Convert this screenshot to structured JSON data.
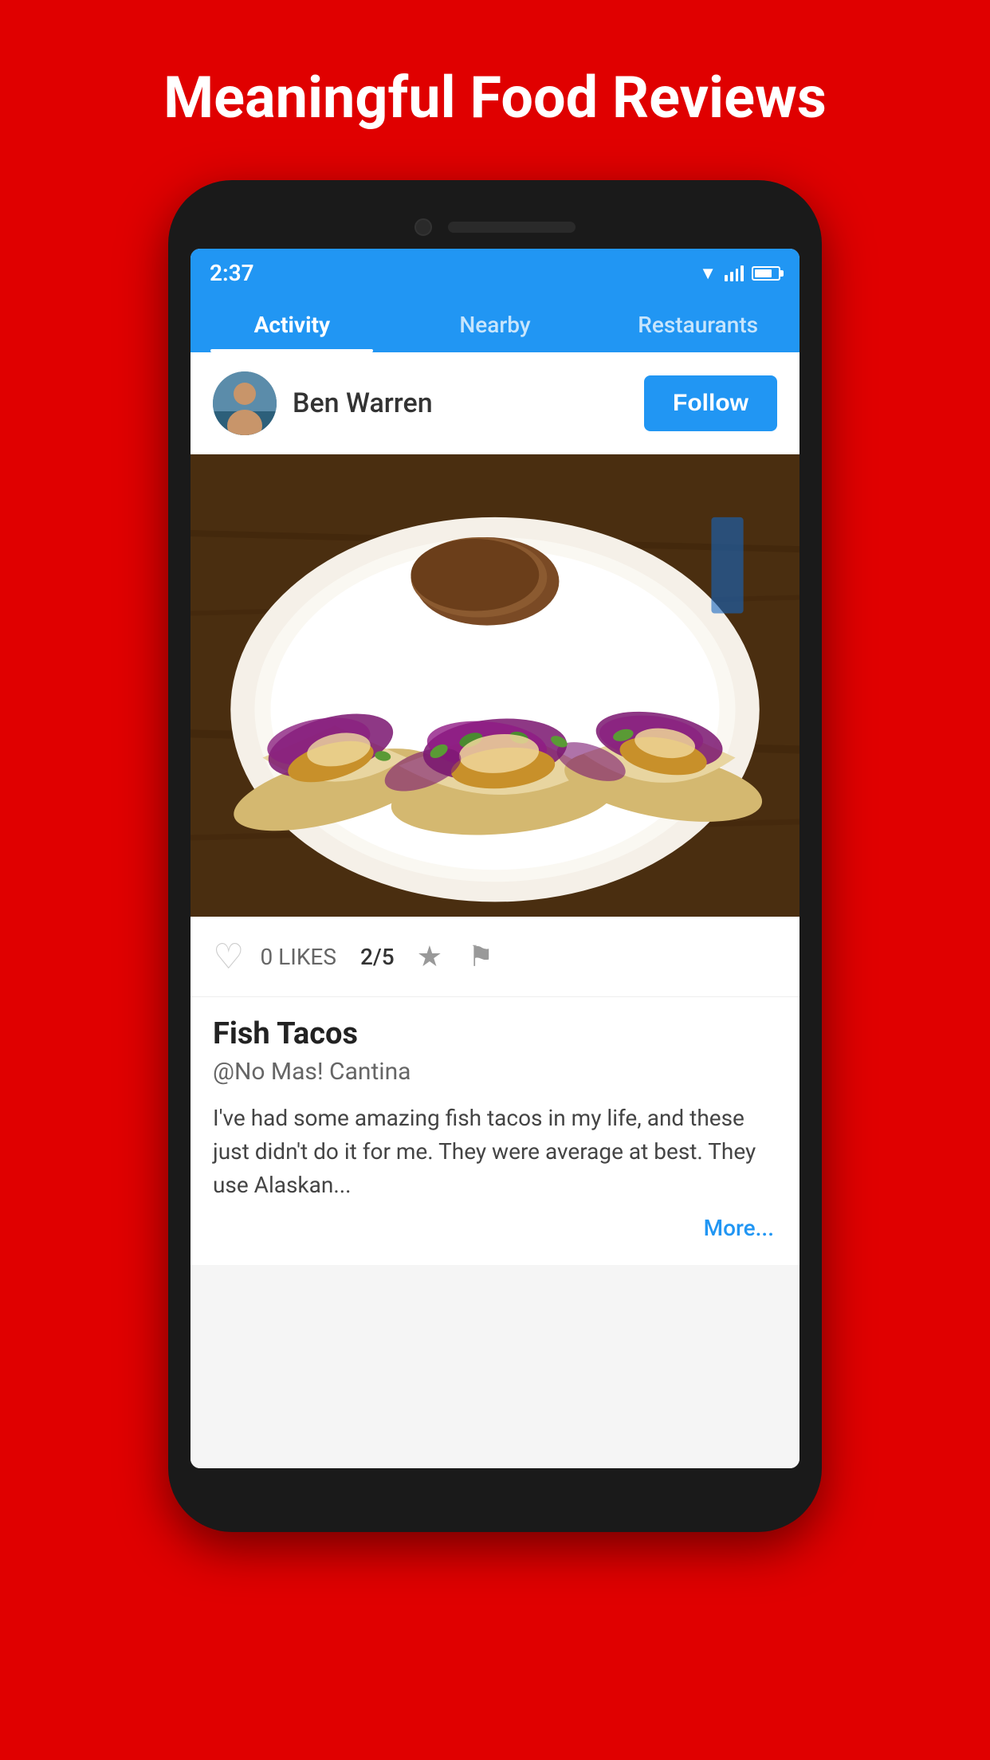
{
  "header": {
    "title": "Meaningful Food Reviews"
  },
  "status_bar": {
    "time": "2:37",
    "wifi_icon": "wifi",
    "signal_icon": "signal",
    "battery_icon": "battery"
  },
  "tabs": [
    {
      "label": "Activity",
      "active": true
    },
    {
      "label": "Nearby",
      "active": false
    },
    {
      "label": "Restaurants",
      "active": false
    }
  ],
  "post": {
    "user": {
      "name": "Ben Warren"
    },
    "follow_button": "Follow",
    "likes_count": "0 LIKES",
    "rating": "2/5",
    "dish_name": "Fish Tacos",
    "restaurant": "@No Mas! Cantina",
    "review_text": "I've had some amazing fish tacos in my life, and these just didn't do it for me. They were average at best. They use Alaskan...",
    "more_link": "More..."
  }
}
